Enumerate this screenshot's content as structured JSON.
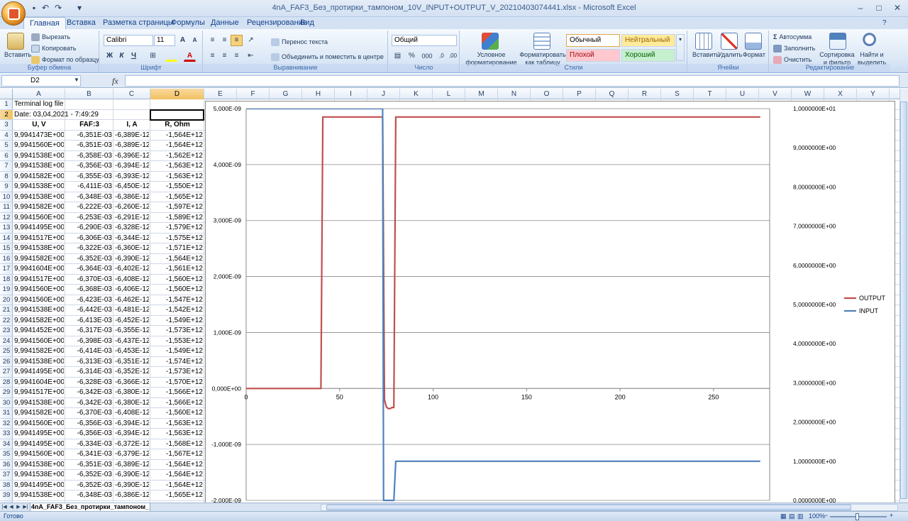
{
  "window": {
    "title": "4nA_FAF3_Без_протирки_тампоном_10V_INPUT+OUTPUT_V_20210403074441.xlsx - Microsoft Excel"
  },
  "ribbon": {
    "tabs": [
      "Главная",
      "Вставка",
      "Разметка страницы",
      "Формулы",
      "Данные",
      "Рецензирование",
      "Вид"
    ],
    "active_tab": "Главная",
    "clipboard": {
      "paste": "Вставить",
      "cut": "Вырезать",
      "copy": "Копировать",
      "format_painter": "Формат по образцу",
      "label": "Буфер обмена"
    },
    "font": {
      "name": "Calibri",
      "size": "11",
      "label": "Шрифт",
      "bold": "Ж",
      "italic": "К",
      "underline": "Ч"
    },
    "alignment": {
      "wrap": "Перенос текста",
      "merge": "Объединить и поместить в центре",
      "label": "Выравнивание"
    },
    "number": {
      "format": "Общий",
      "label": "Число",
      "percent": "%",
      "thousands": "000"
    },
    "styles": {
      "conditional": "Условное форматирование",
      "as_table": "Форматировать как таблицу",
      "normal": "Обычный",
      "neutral": "Нейтральный",
      "bad": "Плохой",
      "good": "Хороший",
      "label": "Стили"
    },
    "cells": {
      "insert": "Вставить",
      "delete": "Удалить",
      "format": "Формат",
      "label": "Ячейки"
    },
    "editing": {
      "autosum": "Автосумма",
      "fill": "Заполнить",
      "clear": "Очистить",
      "sort": "Сортировка и фильтр",
      "find": "Найти и выделить",
      "label": "Редактирование"
    }
  },
  "formula_bar": {
    "name_box": "D2",
    "fx": "fx",
    "value": ""
  },
  "columns": [
    "A",
    "B",
    "C",
    "D",
    "E",
    "F",
    "G",
    "H",
    "I",
    "J",
    "K",
    "L",
    "M",
    "N",
    "O",
    "P",
    "Q",
    "R",
    "S",
    "T",
    "U",
    "V",
    "W",
    "X",
    "Y"
  ],
  "selected_column": "D",
  "rows": [
    "1",
    "2",
    "3",
    "4",
    "5",
    "6",
    "7",
    "8",
    "9",
    "10",
    "11",
    "12",
    "13",
    "14",
    "15",
    "16",
    "17",
    "18",
    "19",
    "20",
    "21",
    "22",
    "23",
    "24",
    "25",
    "26",
    "27",
    "28",
    "29",
    "30",
    "31",
    "32",
    "33",
    "34",
    "35",
    "36",
    "37",
    "38",
    "39"
  ],
  "selected_row": "2",
  "sheet": {
    "a1": "Terminal log file",
    "a2": "Date: 03,04,2021 - 7:49:29",
    "headers": [
      "U, V",
      "FAF:3",
      "I, A",
      "R, Ohm"
    ],
    "data": [
      [
        "9,9941473E+00",
        "-6,351E-03",
        "-6,389E-12",
        "-1,564E+12"
      ],
      [
        "9,9941560E+00",
        "-6,351E-03",
        "-6,389E-12",
        "-1,564E+12"
      ],
      [
        "9,9941538E+00",
        "-6,358E-03",
        "-6,396E-12",
        "-1,562E+12"
      ],
      [
        "9,9941538E+00",
        "-6,356E-03",
        "-6,394E-12",
        "-1,563E+12"
      ],
      [
        "9,9941582E+00",
        "-6,355E-03",
        "-6,393E-12",
        "-1,563E+12"
      ],
      [
        "9,9941538E+00",
        "-6,411E-03",
        "-6,450E-12",
        "-1,550E+12"
      ],
      [
        "9,9941538E+00",
        "-6,348E-03",
        "-6,386E-12",
        "-1,565E+12"
      ],
      [
        "9,9941582E+00",
        "-6,222E-03",
        "-6,260E-12",
        "-1,597E+12"
      ],
      [
        "9,9941560E+00",
        "-6,253E-03",
        "-6,291E-12",
        "-1,589E+12"
      ],
      [
        "9,9941495E+00",
        "-6,290E-03",
        "-6,328E-12",
        "-1,579E+12"
      ],
      [
        "9,9941517E+00",
        "-6,306E-03",
        "-6,344E-12",
        "-1,575E+12"
      ],
      [
        "9,9941538E+00",
        "-6,322E-03",
        "-6,360E-12",
        "-1,571E+12"
      ],
      [
        "9,9941582E+00",
        "-6,352E-03",
        "-6,390E-12",
        "-1,564E+12"
      ],
      [
        "9,9941604E+00",
        "-6,364E-03",
        "-6,402E-12",
        "-1,561E+12"
      ],
      [
        "9,9941517E+00",
        "-6,370E-03",
        "-6,408E-12",
        "-1,560E+12"
      ],
      [
        "9,9941560E+00",
        "-6,368E-03",
        "-6,406E-12",
        "-1,560E+12"
      ],
      [
        "9,9941560E+00",
        "-6,423E-03",
        "-6,462E-12",
        "-1,547E+12"
      ],
      [
        "9,9941538E+00",
        "-6,442E-03",
        "-6,481E-12",
        "-1,542E+12"
      ],
      [
        "9,9941582E+00",
        "-6,413E-03",
        "-6,452E-12",
        "-1,549E+12"
      ],
      [
        "9,9941452E+00",
        "-6,317E-03",
        "-6,355E-12",
        "-1,573E+12"
      ],
      [
        "9,9941560E+00",
        "-6,398E-03",
        "-6,437E-12",
        "-1,553E+12"
      ],
      [
        "9,9941582E+00",
        "-6,414E-03",
        "-6,453E-12",
        "-1,549E+12"
      ],
      [
        "9,9941538E+00",
        "-6,313E-03",
        "-6,351E-12",
        "-1,574E+12"
      ],
      [
        "9,9941495E+00",
        "-6,314E-03",
        "-6,352E-12",
        "-1,573E+12"
      ],
      [
        "9,9941604E+00",
        "-6,328E-03",
        "-6,366E-12",
        "-1,570E+12"
      ],
      [
        "9,9941517E+00",
        "-6,342E-03",
        "-6,380E-12",
        "-1,566E+12"
      ],
      [
        "9,9941538E+00",
        "-6,342E-03",
        "-6,380E-12",
        "-1,566E+12"
      ],
      [
        "9,9941582E+00",
        "-6,370E-03",
        "-6,408E-12",
        "-1,560E+12"
      ],
      [
        "9,9941560E+00",
        "-6,356E-03",
        "-6,394E-12",
        "-1,563E+12"
      ],
      [
        "9,9941495E+00",
        "-6,356E-03",
        "-6,394E-12",
        "-1,563E+12"
      ],
      [
        "9,9941495E+00",
        "-6,334E-03",
        "-6,372E-12",
        "-1,568E+12"
      ],
      [
        "9,9941560E+00",
        "-6,341E-03",
        "-6,379E-12",
        "-1,567E+12"
      ],
      [
        "9,9941538E+00",
        "-6,351E-03",
        "-6,389E-12",
        "-1,564E+12"
      ],
      [
        "9,9941538E+00",
        "-6,352E-03",
        "-6,390E-12",
        "-1,564E+12"
      ],
      [
        "9,9941495E+00",
        "-6,352E-03",
        "-6,390E-12",
        "-1,564E+12"
      ],
      [
        "9,9941538E+00",
        "-6,348E-03",
        "-6,386E-12",
        "-1,565E+12"
      ]
    ]
  },
  "chart_data": {
    "type": "line",
    "title": "",
    "xlabel": "",
    "ylabel": "",
    "xlim": [
      0,
      280
    ],
    "x_ticks": [
      "0",
      "50",
      "100",
      "150",
      "200",
      "250"
    ],
    "x_tick_values": [
      0,
      50,
      100,
      150,
      200,
      250
    ],
    "y_left_lim": [
      -2e-09,
      5e-09
    ],
    "y_left_ticks": [
      "5,000E-09",
      "4,000E-09",
      "3,000E-09",
      "2,000E-09",
      "1,000E-09",
      "0,000E+00",
      "-1,000E-09",
      "-2,000E-09"
    ],
    "y_left_tick_values": [
      5e-09,
      4e-09,
      3e-09,
      2e-09,
      1e-09,
      0,
      -1e-09,
      -2e-09
    ],
    "y_right_lim": [
      0,
      10
    ],
    "y_right_ticks": [
      "1,0000000E+01",
      "9,0000000E+00",
      "8,0000000E+00",
      "7,0000000E+00",
      "6,0000000E+00",
      "5,0000000E+00",
      "4,0000000E+00",
      "3,0000000E+00",
      "2,0000000E+00",
      "1,0000000E+00",
      "0,0000000E+00"
    ],
    "y_right_tick_values": [
      10,
      9,
      8,
      7,
      6,
      5,
      4,
      3,
      2,
      1,
      0
    ],
    "grid": true,
    "legend_position": "right",
    "series": [
      {
        "name": "OUTPUT",
        "axis": "left",
        "color": "#c0504d",
        "x": [
          0,
          40,
          41,
          72,
          73,
          74,
          75,
          76,
          77,
          78,
          79,
          80,
          81,
          82,
          275
        ],
        "y": [
          0,
          0,
          4.85e-09,
          4.85e-09,
          4.85e-09,
          -2e-10,
          -3.3e-10,
          -3.6e-10,
          -3.6e-10,
          -3.4e-10,
          -3.4e-10,
          4.85e-09,
          4.85e-09,
          4.85e-09,
          4.85e-09
        ]
      },
      {
        "name": "INPUT",
        "axis": "right",
        "color": "#4f81bd",
        "x": [
          0,
          73,
          73.5,
          79,
          80,
          82,
          275
        ],
        "y": [
          10.0,
          10.0,
          0.0,
          0.0,
          1.0,
          1.0,
          1.0
        ]
      }
    ]
  },
  "sheet_tab": {
    "name": "4nA_FAF3_Без_протирки_тампоном_"
  },
  "status": {
    "ready": "Готово",
    "zoom": "100%"
  },
  "colors": {
    "accent": "#15428b",
    "output": "#c0504d",
    "input": "#4f81bd",
    "selection": "#f1c15f"
  }
}
